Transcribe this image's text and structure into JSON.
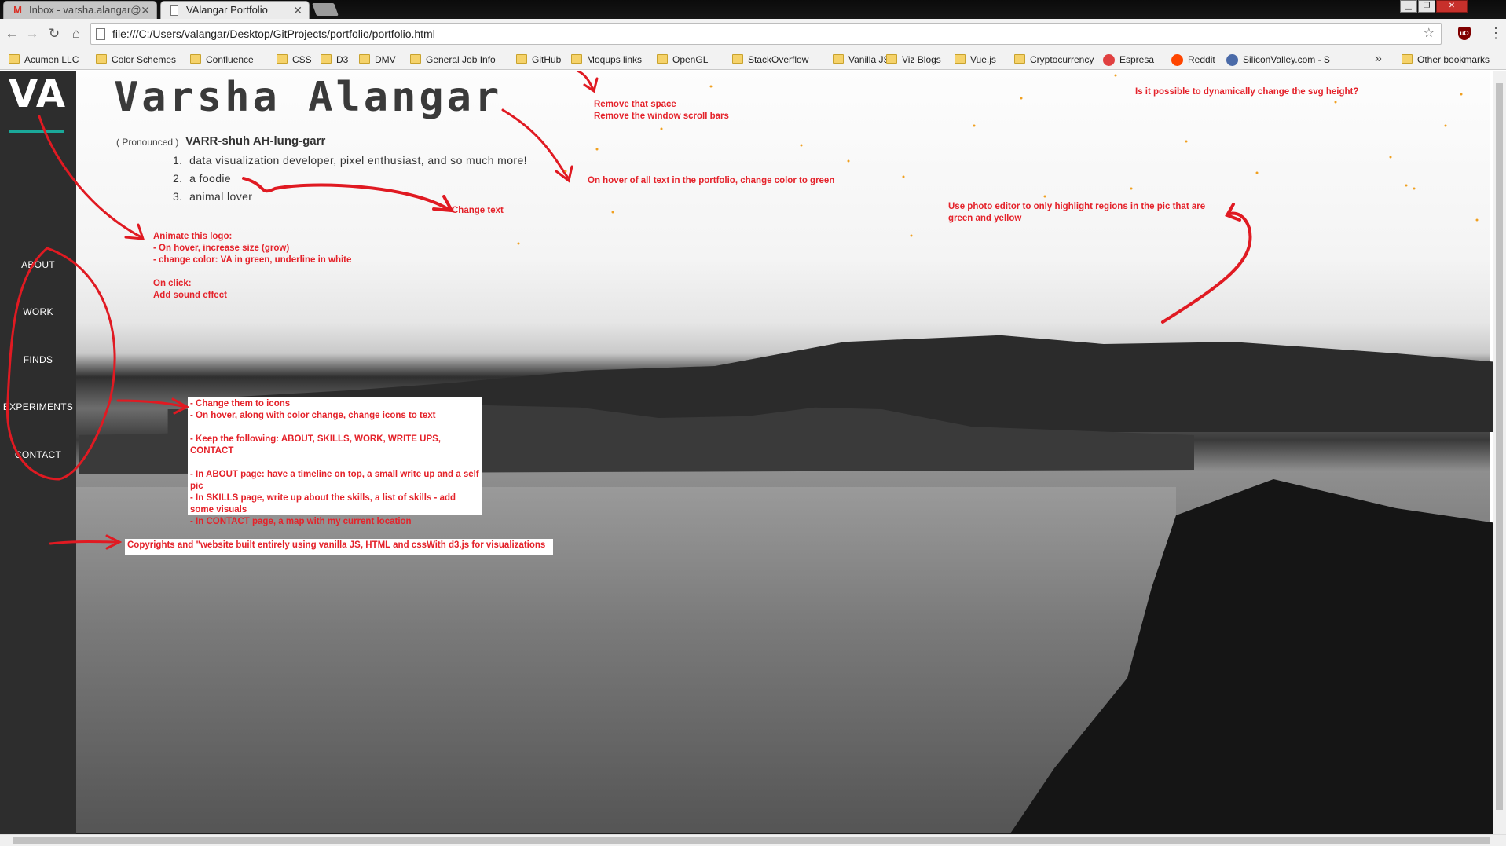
{
  "tabs": [
    {
      "title": "Inbox - varsha.alangar@",
      "icon": "gmail-icon",
      "active": false
    },
    {
      "title": "VAlangar Portfolio",
      "icon": "page-icon",
      "active": true
    }
  ],
  "toolbar": {
    "url": "file:///C:/Users/valangar/Desktop/GitProjects/portfolio/portfolio.html"
  },
  "bookmarks": [
    {
      "label": "Acumen LLC",
      "type": "folder"
    },
    {
      "label": "Color Schemes",
      "type": "folder"
    },
    {
      "label": "Confluence",
      "type": "folder"
    },
    {
      "label": "CSS",
      "type": "folder"
    },
    {
      "label": "D3",
      "type": "folder"
    },
    {
      "label": "DMV",
      "type": "folder"
    },
    {
      "label": "General Job Info",
      "type": "folder"
    },
    {
      "label": "GitHub",
      "type": "folder"
    },
    {
      "label": "Moqups links",
      "type": "folder"
    },
    {
      "label": "OpenGL",
      "type": "folder"
    },
    {
      "label": "StackOverflow",
      "type": "folder"
    },
    {
      "label": "Vanilla JS",
      "type": "folder"
    },
    {
      "label": "Viz Blogs",
      "type": "folder"
    },
    {
      "label": "Vue.js",
      "type": "folder"
    },
    {
      "label": "Cryptocurrency",
      "type": "folder"
    },
    {
      "label": "Espresa",
      "type": "site"
    },
    {
      "label": "Reddit",
      "type": "site"
    },
    {
      "label": "SiliconValley.com - S",
      "type": "site"
    }
  ],
  "other_bookmarks": "Other bookmarks",
  "sidebar": {
    "logo": "VA",
    "nav": [
      "ABOUT",
      "WORK",
      "FINDS",
      "EXPERIMENTS",
      "CONTACT"
    ]
  },
  "hero": {
    "name": "Varsha Alangar",
    "pronounced_label": "( Pronounced )",
    "pronunciation": "VARR-shuh AH-lung-garr",
    "list": [
      "data visualization developer, pixel enthusiast, and so much more!",
      "a foodie",
      "animal lover"
    ]
  },
  "notes": {
    "space": "Remove that space\nRemove the window scroll bars",
    "hover": "On hover of all text in the portfolio, change color to green",
    "svg": "Is it possible to dynamically change the svg height?",
    "change_text": "Change text",
    "photo": "Use photo editor to only highlight regions in the pic that are\ngreen and yellow",
    "logo": "Animate this logo:\n- On hover, increase size (grow)\n- change color: VA in green, underline in white\n\nOn click:\nAdd sound effect",
    "nav": "- Change them to icons\n- On hover, along with color change, change icons to text\n\n- Keep the following: ABOUT, SKILLS, WORK, WRITE UPS,\nCONTACT\n\n- In ABOUT page: have a timeline on top, a small write up and a self\npic\n- In SKILLS page, write up about the skills, a list of skills - add\nsome visuals\n- In CONTACT page, a map with my current location",
    "footer": "Copyrights and \"website built entirely using vanilla JS, HTML and cssWith d3.js for visualizations"
  },
  "colors": {
    "annotation": "#e4222a",
    "sidebar": "#2d2d2d",
    "logo_underline": "#1aa899"
  }
}
